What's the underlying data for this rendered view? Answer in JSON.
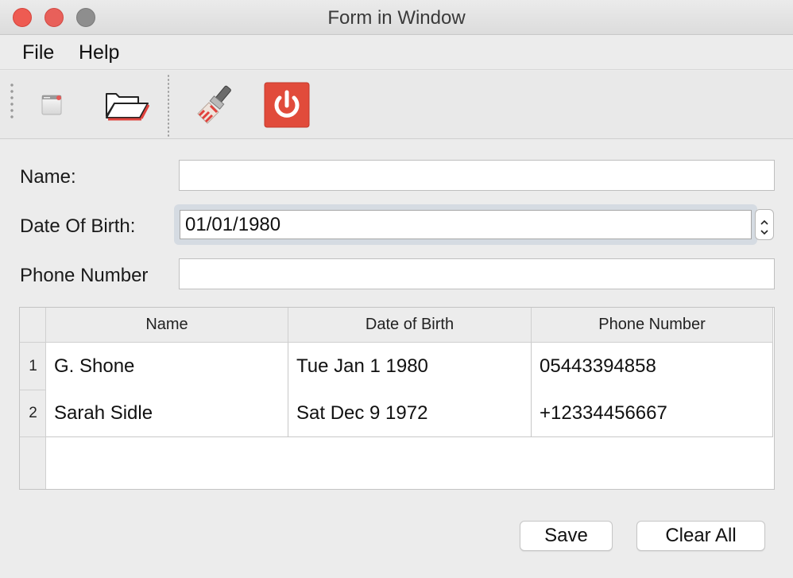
{
  "window": {
    "title": "Form in Window"
  },
  "menu": {
    "file": "File",
    "help": "Help"
  },
  "toolbar": {
    "icons": [
      "new-window-icon",
      "open-folder-icon",
      "clear-brush-icon",
      "power-icon"
    ],
    "accent": "#e14b3b"
  },
  "form": {
    "name_label": "Name:",
    "name_value": "",
    "dob_label": "Date Of Birth:",
    "dob_value": "01/01/1980",
    "phone_label": "Phone Number",
    "phone_value": ""
  },
  "table": {
    "headers": [
      "Name",
      "Date of Birth",
      "Phone Number"
    ],
    "rows": [
      {
        "num": "1",
        "name": "G. Shone",
        "dob": "Tue Jan 1 1980",
        "phone": "05443394858"
      },
      {
        "num": "2",
        "name": "Sarah Sidle",
        "dob": "Sat Dec 9 1972",
        "phone": "+12334456667"
      }
    ]
  },
  "buttons": {
    "save": "Save",
    "clear_all": "Clear All"
  }
}
